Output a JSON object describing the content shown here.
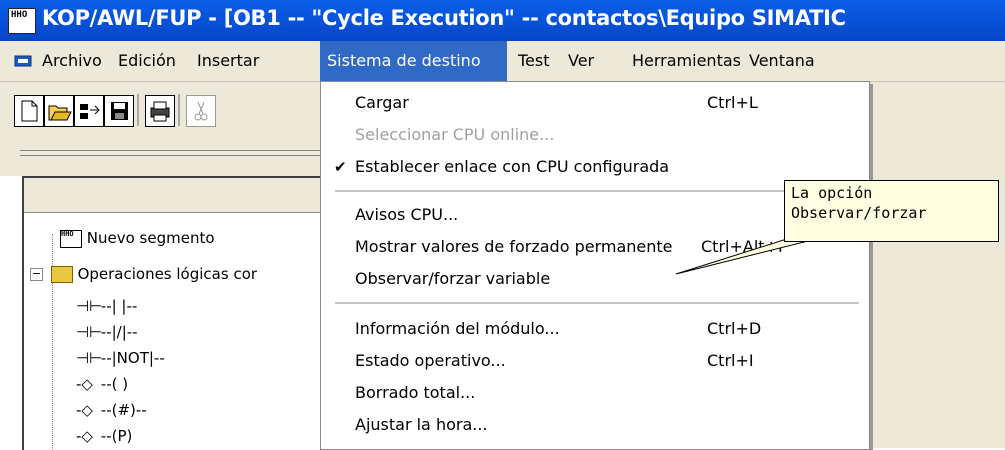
{
  "window": {
    "title": "KOP/AWL/FUP  - [OB1 -- \"Cycle Execution\" -- contactos\\Equipo SIMATIC",
    "app_icon_text": "HHO"
  },
  "menubar": {
    "items": [
      "Archivo",
      "Edición",
      "Insertar",
      "Sistema de destino",
      "Test",
      "Ver",
      "Herramientas",
      "Ventana"
    ],
    "active": "Sistema de destino"
  },
  "toolbar": {
    "buttons": [
      "new-icon",
      "open-icon",
      "network-icon",
      "save-icon",
      "print-icon",
      "cut-icon"
    ]
  },
  "tree": {
    "items": [
      {
        "icon": "HHO",
        "label": "Nuevo segmento"
      },
      {
        "icon": "folder",
        "label": "Operaciones lógicas cor"
      },
      {
        "icon": "contact",
        "label": "--| |--"
      },
      {
        "icon": "contact",
        "label": "--|/|--"
      },
      {
        "icon": "contact",
        "label": "--|NOT|--"
      },
      {
        "icon": "coil",
        "label": "--( )"
      },
      {
        "icon": "coil",
        "label": "--(#)--"
      },
      {
        "icon": "coil",
        "label": "--(P)"
      }
    ]
  },
  "dropdown": {
    "items": [
      {
        "label": "Cargar",
        "shortcut": "Ctrl+L",
        "disabled": false,
        "checked": false
      },
      {
        "label": "Seleccionar CPU online...",
        "shortcut": "",
        "disabled": true,
        "checked": false
      },
      {
        "label": "Establecer enlace con CPU configurada",
        "shortcut": "",
        "disabled": false,
        "checked": true
      },
      {
        "label": "Avisos CPU...",
        "shortcut": "",
        "disabled": false,
        "checked": false
      },
      {
        "label": "Mostrar valores de forzado permanente",
        "shortcut": "Ctrl+Alt+F",
        "disabled": false,
        "checked": false
      },
      {
        "label": "Observar/forzar variable",
        "shortcut": "",
        "disabled": false,
        "checked": false
      },
      {
        "label": "Información del módulo...",
        "shortcut": "Ctrl+D",
        "disabled": false,
        "checked": false
      },
      {
        "label": "Estado operativo...",
        "shortcut": "Ctrl+I",
        "disabled": false,
        "checked": false
      },
      {
        "label": "Borrado total...",
        "shortcut": "",
        "disabled": false,
        "checked": false
      },
      {
        "label": "Ajustar la hora...",
        "shortcut": "",
        "disabled": false,
        "checked": false
      }
    ]
  },
  "callout": {
    "line1": "La opción",
    "line2": "Observar/forzar"
  },
  "colors": {
    "title_bar": "#0a5fe8",
    "menu_highlight": "#3169c6",
    "callout_bg": "#ffffe1"
  }
}
